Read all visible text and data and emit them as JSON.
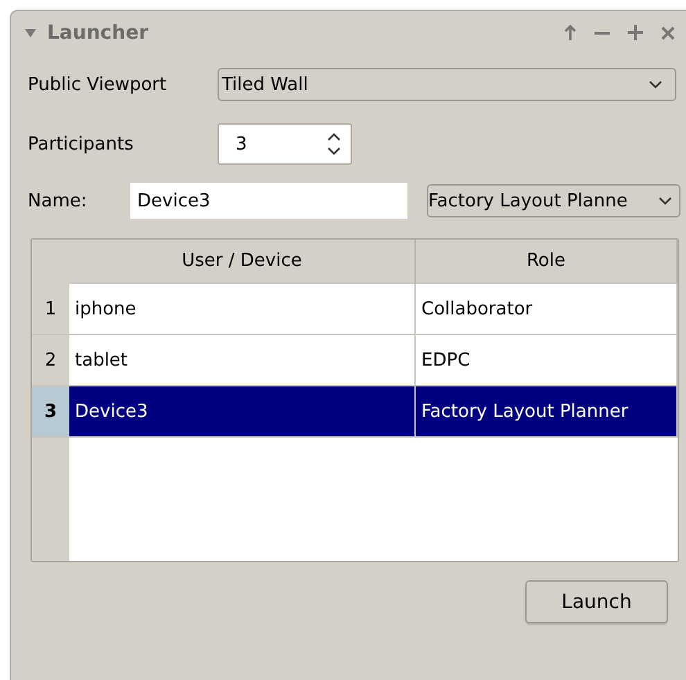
{
  "window": {
    "title": "Launcher"
  },
  "form": {
    "viewport": {
      "label": "Public Viewport",
      "value": "Tiled Wall"
    },
    "participants": {
      "label": "Participants",
      "value": "3"
    },
    "name": {
      "label": "Name:",
      "value": "Device3",
      "role": "Factory Layout Planne"
    }
  },
  "table": {
    "columns": [
      "User / Device",
      "Role"
    ],
    "rows": [
      {
        "number": "1",
        "cells": [
          "iphone",
          "Collaborator"
        ],
        "selected": false
      },
      {
        "number": "2",
        "cells": [
          "tablet",
          "EDPC"
        ],
        "selected": false
      },
      {
        "number": "3",
        "cells": [
          "Device3",
          "Factory Layout Planner"
        ],
        "selected": true
      }
    ]
  },
  "buttons": [
    "Launch"
  ]
}
